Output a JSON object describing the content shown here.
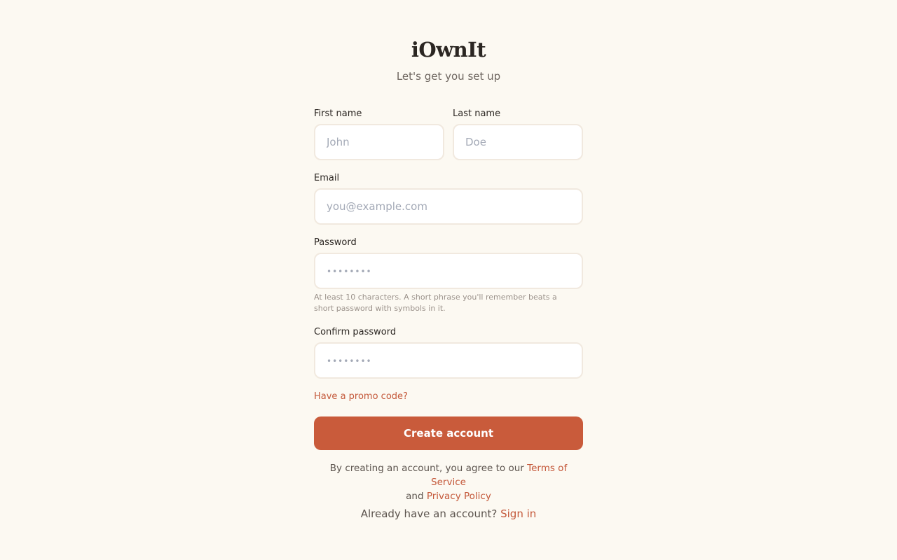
{
  "brand": {
    "name": "iOwnIt",
    "subtitle": "Let's get you set up"
  },
  "form": {
    "first_name": {
      "label": "First name",
      "placeholder": "John",
      "value": ""
    },
    "last_name": {
      "label": "Last name",
      "placeholder": "Doe",
      "value": ""
    },
    "email": {
      "label": "Email",
      "placeholder": "you@example.com",
      "value": ""
    },
    "password": {
      "label": "Password",
      "placeholder": "••••••••",
      "hint": "At least 10 characters. A short phrase you'll remember beats a short password with symbols in it."
    },
    "confirm_password": {
      "label": "Confirm password",
      "placeholder": "••••••••"
    },
    "promo_link": "Have a promo code?",
    "submit_label": "Create account"
  },
  "legal": {
    "prefix": "By creating an account, you agree to our",
    "terms_link": "Terms of Service",
    "and": "and",
    "privacy_link": "Privacy Policy"
  },
  "signin": {
    "prompt": "Already have an account?",
    "link": "Sign in"
  },
  "colors": {
    "background": "#fcf9f2",
    "accent": "#c95b3b",
    "input_border": "#f1e9df"
  }
}
